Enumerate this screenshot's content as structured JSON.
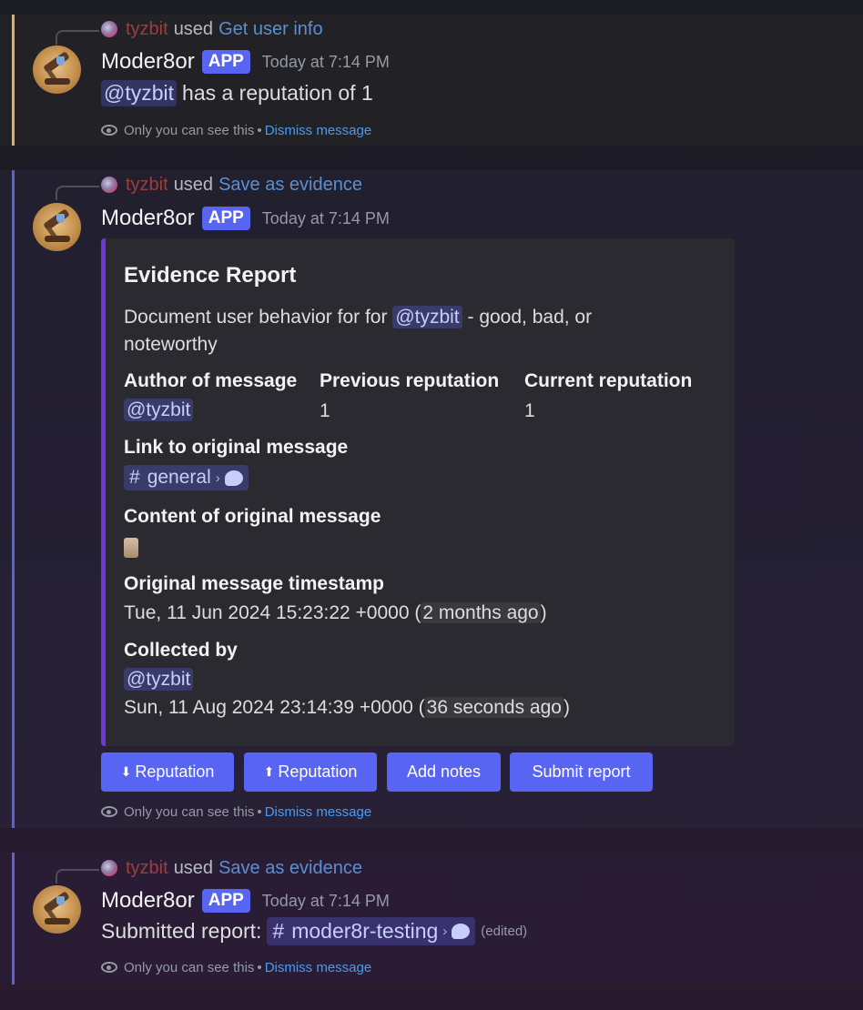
{
  "messages": [
    {
      "reply": {
        "user": "tyzbit",
        "used": "used",
        "command": "Get user info"
      },
      "author": "Moder8or",
      "badge": "APP",
      "timestamp": "Today at 7:14 PM",
      "content": {
        "mention": "@tyzbit",
        "text": "has a reputation of 1"
      },
      "ephemeral": {
        "note": "Only you can see this",
        "sep": "•",
        "dismiss": "Dismiss message"
      }
    },
    {
      "reply": {
        "user": "tyzbit",
        "used": "used",
        "command": "Save as evidence"
      },
      "author": "Moder8or",
      "badge": "APP",
      "timestamp": "Today at 7:14 PM",
      "embed": {
        "accent": "#6d39d8",
        "title": "Evidence Report",
        "desc_prefix": "Document user behavior for for",
        "desc_mention": "@tyzbit",
        "desc_suffix": "- good, bad, or noteworthy",
        "fields": {
          "author_name": "Author of message",
          "author_value": "@tyzbit",
          "prev_name": "Previous reputation",
          "prev_value": "1",
          "curr_name": "Current reputation",
          "curr_value": "1",
          "link_name": "Link to original message",
          "link_channel": "general",
          "content_name": "Content of original message",
          "ts_name": "Original message timestamp",
          "ts_value": "Tue, 11 Jun 2024 15:23:22 +0000",
          "ts_relative": "2 months ago",
          "collected_name": "Collected by",
          "collected_mention": "@tyzbit",
          "collected_ts": "Sun, 11 Aug 2024 23:14:39 +0000",
          "collected_relative": "36 seconds ago"
        }
      },
      "buttons": [
        {
          "icon": "⬇",
          "label": "Reputation"
        },
        {
          "icon": "⬆",
          "label": "Reputation"
        },
        {
          "icon": "",
          "label": "Add notes"
        },
        {
          "icon": "",
          "label": "Submit report"
        }
      ],
      "ephemeral": {
        "note": "Only you can see this",
        "sep": "•",
        "dismiss": "Dismiss message"
      }
    },
    {
      "reply": {
        "user": "tyzbit",
        "used": "used",
        "command": "Save as evidence"
      },
      "author": "Moder8or",
      "badge": "APP",
      "timestamp": "Today at 7:14 PM",
      "content": {
        "text": "Submitted report:",
        "channel": "moder8r-testing",
        "edited": "(edited)"
      },
      "ephemeral": {
        "note": "Only you can see this",
        "sep": "•",
        "dismiss": "Dismiss message"
      }
    }
  ],
  "colors": {
    "blurple": "#5865f2",
    "accent_gold": "#e0b165",
    "accent_blue": "#5b62d6"
  }
}
